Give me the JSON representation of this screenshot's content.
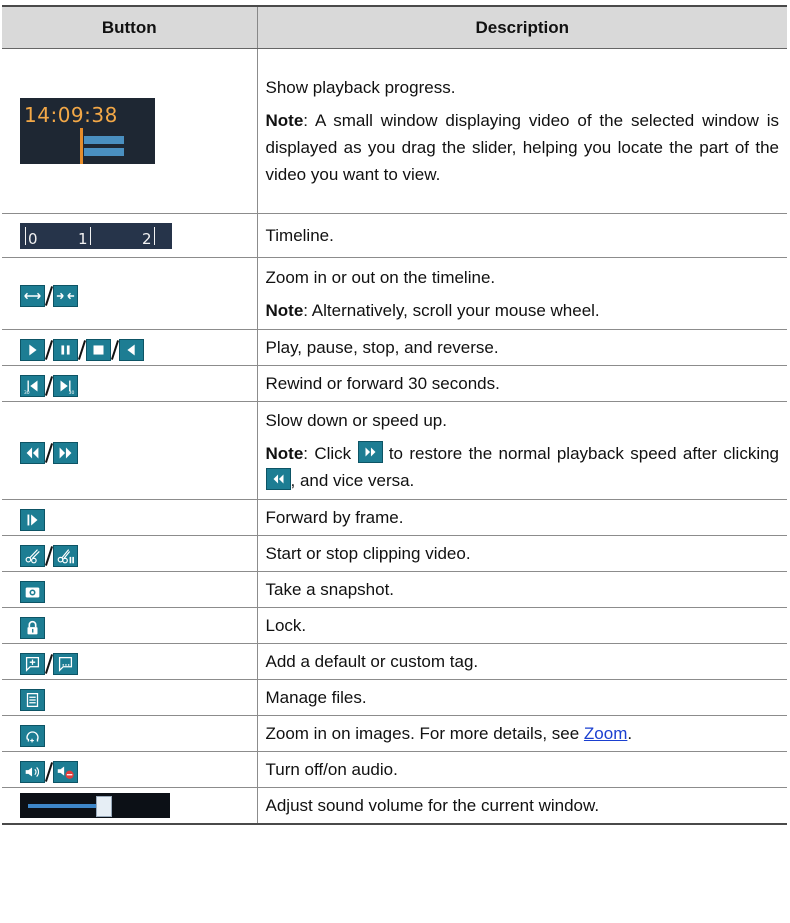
{
  "header": {
    "button": "Button",
    "description": "Description"
  },
  "rows": [
    {
      "icon": "playback-progress-thumbnail",
      "time": "14:09:38",
      "desc": "Show playback progress.",
      "note_label": "Note",
      "note": ": A small window displaying video of the selected window is displayed as you drag the slider, helping you locate the part of the video you want to view."
    },
    {
      "icon": "timeline-thumbnail",
      "ticks": [
        "0",
        "1",
        "2"
      ],
      "desc": "Timeline."
    },
    {
      "icons": [
        "zoom-out-timeline-icon",
        "zoom-in-timeline-icon"
      ],
      "desc": "Zoom in or out on the timeline.",
      "note_label": "Note",
      "note": ": Alternatively, scroll your mouse wheel."
    },
    {
      "icons": [
        "play-icon",
        "pause-icon",
        "stop-icon",
        "reverse-icon"
      ],
      "desc": "Play, pause, stop, and reverse."
    },
    {
      "icons": [
        "rewind-30s-icon",
        "forward-30s-icon"
      ],
      "desc": "Rewind or forward 30 seconds."
    },
    {
      "icons": [
        "slow-down-icon",
        "speed-up-icon"
      ],
      "desc": "Slow down or speed up.",
      "note_label": "Note",
      "note_a": ": Click ",
      "note_b": " to restore the normal playback speed after clicking ",
      "note_c": ", and vice versa."
    },
    {
      "icons": [
        "frame-forward-icon"
      ],
      "desc": "Forward by frame."
    },
    {
      "icons": [
        "start-clip-icon",
        "stop-clip-icon"
      ],
      "desc": "Start or stop clipping video."
    },
    {
      "icons": [
        "snapshot-icon"
      ],
      "desc": "Take a snapshot."
    },
    {
      "icons": [
        "lock-icon"
      ],
      "desc": "Lock."
    },
    {
      "icons": [
        "default-tag-icon",
        "custom-tag-icon"
      ],
      "desc": "Add a default or custom tag."
    },
    {
      "icons": [
        "manage-files-icon"
      ],
      "desc": "Manage files."
    },
    {
      "icons": [
        "zoom-image-icon"
      ],
      "desc_a": "Zoom in on images. For more details, see ",
      "link": "Zoom",
      "desc_b": "."
    },
    {
      "icons": [
        "audio-on-icon",
        "audio-off-icon"
      ],
      "desc": "Turn off/on audio."
    },
    {
      "icon": "volume-slider-thumbnail",
      "volume_level": 0.55,
      "desc": "Adjust sound volume for the current window."
    }
  ],
  "colors": {
    "icon_bg": "#1d7d93",
    "header_bg": "#d9d9d9",
    "link": "#1a3fd0",
    "progress_time": "#f3a847"
  }
}
